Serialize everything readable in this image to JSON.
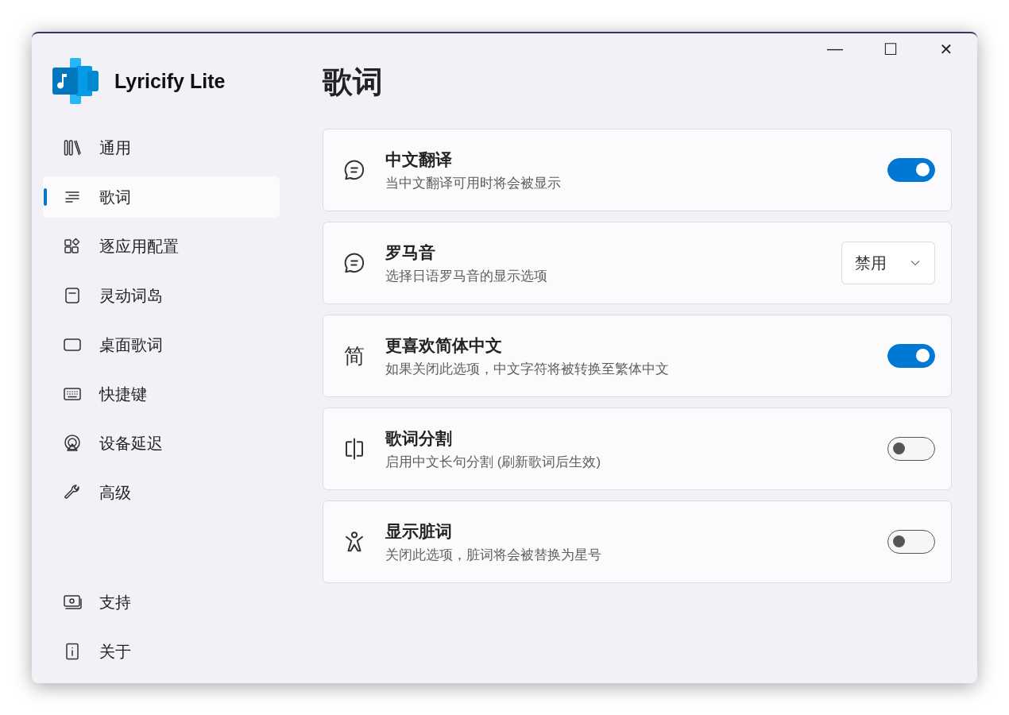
{
  "app": {
    "name": "Lyricify Lite"
  },
  "window_controls": {
    "minimize": "—",
    "maximize": "☐",
    "close": "✕"
  },
  "nav_items": [
    {
      "label": "通用",
      "selected": false
    },
    {
      "label": "歌词",
      "selected": true
    },
    {
      "label": "逐应用配置",
      "selected": false
    },
    {
      "label": "灵动词岛",
      "selected": false
    },
    {
      "label": "桌面歌词",
      "selected": false
    },
    {
      "label": "快捷键",
      "selected": false
    },
    {
      "label": "设备延迟",
      "selected": false
    },
    {
      "label": "高级",
      "selected": false
    }
  ],
  "footer_items": [
    {
      "label": "支持",
      "selected": false
    },
    {
      "label": "关于",
      "selected": false
    }
  ],
  "page_title": "歌词",
  "settings": [
    {
      "kind": "toggle",
      "title": "中文翻译",
      "description": "当中文翻译可用时将会被显示",
      "on": true
    },
    {
      "kind": "dropdown",
      "title": "罗马音",
      "description": "选择日语罗马音的显示选项",
      "value": "禁用"
    },
    {
      "kind": "toggle",
      "icon_char": "简",
      "title": "更喜欢简体中文",
      "description": "如果关闭此选项，中文字符将被转换至繁体中文",
      "on": true
    },
    {
      "kind": "toggle",
      "title": "歌词分割",
      "description": "启用中文长句分割 (刷新歌词后生效)",
      "on": false
    },
    {
      "kind": "toggle",
      "title": "显示脏词",
      "description": "关闭此选项，脏词将会被替换为星号",
      "on": false
    }
  ]
}
